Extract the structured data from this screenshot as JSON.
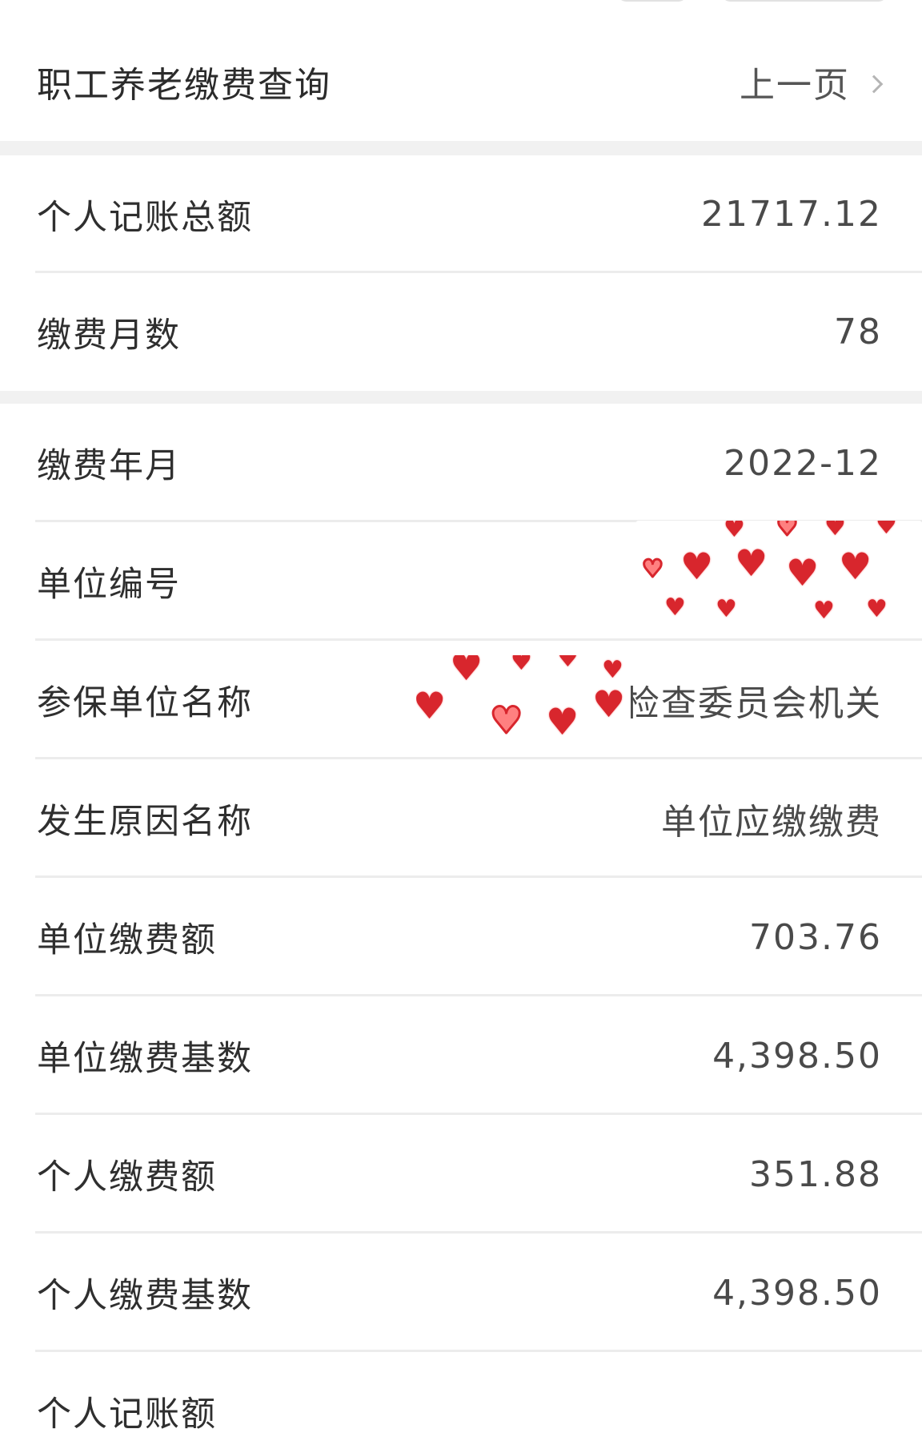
{
  "header": {
    "title": "职工养老缴费查询",
    "prev_label": "上一页"
  },
  "summary": [
    {
      "label": "个人记账总额",
      "value": "21717.12"
    },
    {
      "label": "缴费月数",
      "value": "78"
    }
  ],
  "details": [
    {
      "label": "缴费年月",
      "value": "2022-12"
    },
    {
      "label": "单位编号",
      "value": ""
    },
    {
      "label": "参保单位名称",
      "value": "中共           检查委员会机关"
    },
    {
      "label": "发生原因名称",
      "value": "单位应缴缴费"
    },
    {
      "label": "单位缴费额",
      "value": "703.76"
    },
    {
      "label": "单位缴费基数",
      "value": "4,398.50"
    },
    {
      "label": "个人缴费额",
      "value": "351.88"
    },
    {
      "label": "个人缴费基数",
      "value": "4,398.50"
    },
    {
      "label": "个人记账额",
      "value": ""
    }
  ],
  "colors": {
    "heart": "#d8262d",
    "divider": "#ececec",
    "section_gap": "#f1f1f1"
  }
}
